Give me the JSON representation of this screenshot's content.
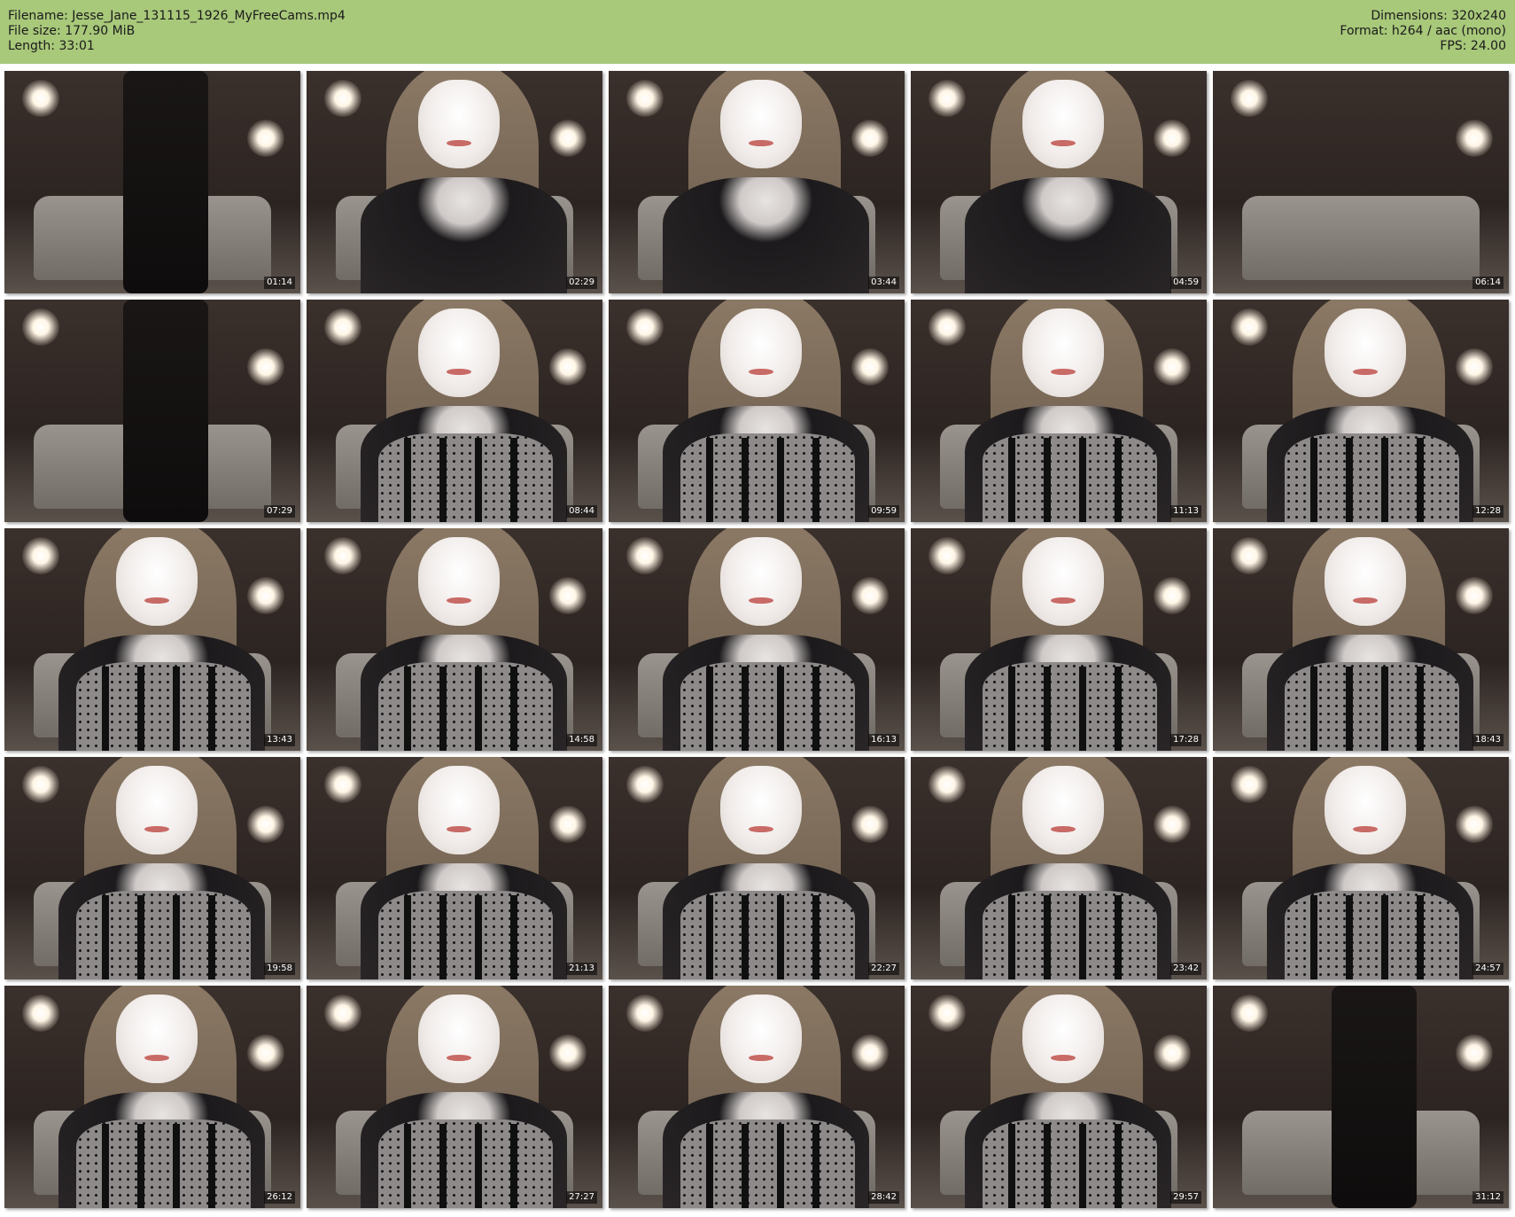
{
  "header": {
    "filename_line": "Filename: Jesse_Jane_131115_1926_MyFreeCams.mp4",
    "filesize_line": "File size: 177.90 MiB",
    "length_line": "Length: 33:01",
    "dimensions_line": "Dimensions: 320x240",
    "format_line": "Format: h264 / aac (mono)",
    "fps_line": "FPS: 24.00",
    "background_color": "#a8c87a"
  },
  "thumbnails": [
    {
      "timestamp": "01:14",
      "scene": "standing-black-dress"
    },
    {
      "timestamp": "02:29",
      "scene": "close-up-black-top"
    },
    {
      "timestamp": "03:44",
      "scene": "close-up-black-top"
    },
    {
      "timestamp": "04:59",
      "scene": "close-up-black-top"
    },
    {
      "timestamp": "06:14",
      "scene": "empty-room-couch"
    },
    {
      "timestamp": "07:29",
      "scene": "standing-lace-outfit"
    },
    {
      "timestamp": "08:44",
      "scene": "close-up-lace-top"
    },
    {
      "timestamp": "09:59",
      "scene": "close-up-lace-top"
    },
    {
      "timestamp": "11:13",
      "scene": "close-up-lace-top"
    },
    {
      "timestamp": "12:28",
      "scene": "close-up-lace-top"
    },
    {
      "timestamp": "13:43",
      "scene": "close-up-lace-top"
    },
    {
      "timestamp": "14:58",
      "scene": "close-up-lace-top"
    },
    {
      "timestamp": "16:13",
      "scene": "close-up-lace-top"
    },
    {
      "timestamp": "17:28",
      "scene": "close-up-lace-top"
    },
    {
      "timestamp": "18:43",
      "scene": "close-up-lace-top"
    },
    {
      "timestamp": "19:58",
      "scene": "close-up-lace-top"
    },
    {
      "timestamp": "21:13",
      "scene": "close-up-lace-top"
    },
    {
      "timestamp": "22:27",
      "scene": "close-up-lace-top-holding-object"
    },
    {
      "timestamp": "23:42",
      "scene": "close-up-lace-top"
    },
    {
      "timestamp": "24:57",
      "scene": "close-up-lace-top"
    },
    {
      "timestamp": "26:12",
      "scene": "close-up-lace-top"
    },
    {
      "timestamp": "27:27",
      "scene": "close-up-lace-top"
    },
    {
      "timestamp": "28:42",
      "scene": "close-up-lace-top"
    },
    {
      "timestamp": "29:57",
      "scene": "close-up-lace-top"
    },
    {
      "timestamp": "31:12",
      "scene": "standing-crop-top"
    }
  ]
}
